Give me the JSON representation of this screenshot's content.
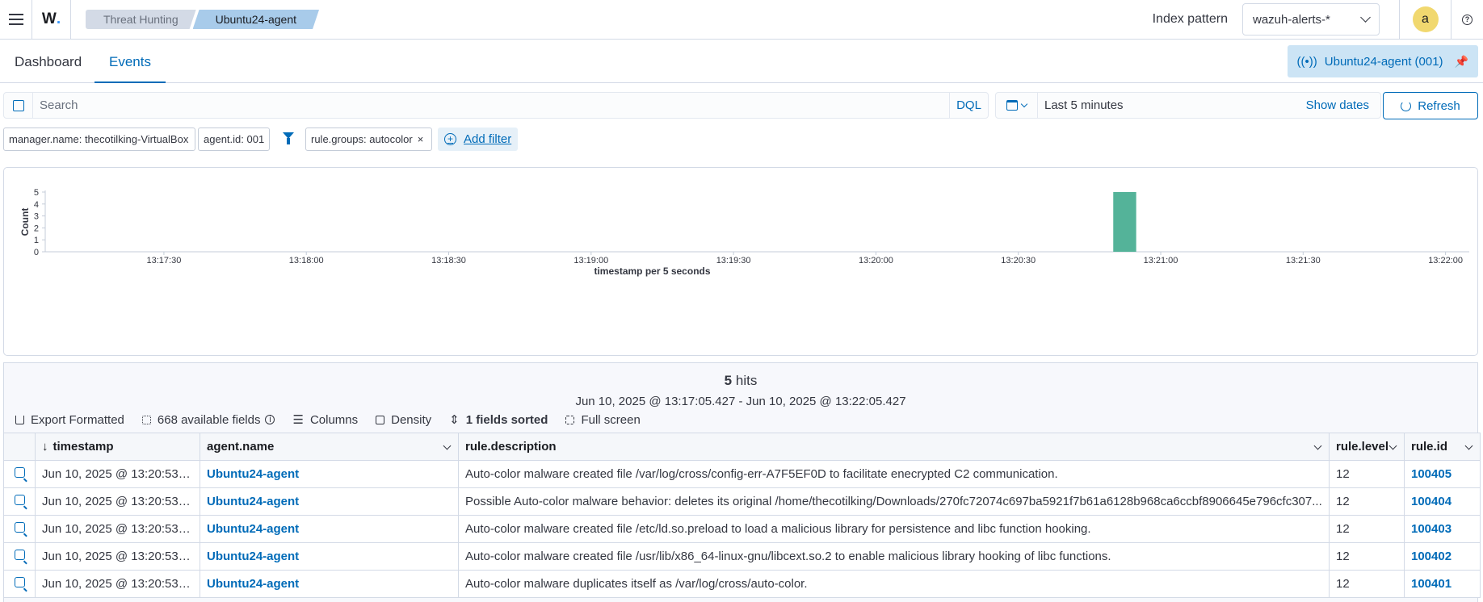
{
  "header": {
    "logo": "W",
    "breadcrumbs": [
      "Threat Hunting",
      "Ubuntu24-agent"
    ],
    "index_pattern_label": "Index pattern",
    "index_pattern_value": "wazuh-alerts-*",
    "avatar_letter": "a"
  },
  "tabs": [
    {
      "label": "Dashboard"
    },
    {
      "label": "Events"
    }
  ],
  "pinned_agent": "Ubuntu24-agent (001)",
  "search": {
    "placeholder": "Search",
    "language": "DQL",
    "time_range": "Last 5 minutes",
    "show_dates": "Show dates",
    "refresh": "Refresh"
  },
  "filters": [
    {
      "label": "manager.name: thecotilking-VirtualBox"
    },
    {
      "label": "agent.id: 001"
    },
    {
      "label": "rule.groups: autocolor"
    }
  ],
  "add_filter": "Add filter",
  "chart_data": {
    "type": "bar",
    "x": [
      "13:20:50"
    ],
    "values": [
      5
    ],
    "ylabel": "Count",
    "xlabel": "timestamp per 5 seconds",
    "ylim": [
      0,
      5
    ],
    "y_ticks": [
      "0",
      "1",
      "2",
      "3",
      "4",
      "5"
    ],
    "x_ticks": [
      "13:17:30",
      "13:18:00",
      "13:18:30",
      "13:19:00",
      "13:19:30",
      "13:20:00",
      "13:20:30",
      "13:21:00",
      "13:21:30",
      "13:22:00"
    ],
    "x_range": [
      "13:17:05",
      "13:22:05"
    ],
    "bar_color": "#54b399",
    "grid": false
  },
  "results": {
    "hits_count": "5",
    "hits_label": "hits",
    "date_range": "Jun 10, 2025 @ 13:17:05.427 - Jun 10, 2025 @ 13:22:05.427",
    "toolbar": {
      "export": "Export Formatted",
      "fields": "668 available fields",
      "columns": "Columns",
      "density": "Density",
      "sorted": "1 fields sorted",
      "fullscreen": "Full screen"
    },
    "columns": [
      "timestamp",
      "agent.name",
      "rule.description",
      "rule.level",
      "rule.id"
    ],
    "rows": [
      {
        "timestamp": "Jun 10, 2025 @ 13:20:53.1...",
        "agent": "Ubuntu24-agent",
        "description": "Auto-color malware created file /var/log/cross/config-err-A7F5EF0D to facilitate enecrypted C2 communication.",
        "level": "12",
        "id": "100405"
      },
      {
        "timestamp": "Jun 10, 2025 @ 13:20:53.1...",
        "agent": "Ubuntu24-agent",
        "description": "Possible Auto-color malware behavior: deletes its original /home/thecotilking/Downloads/270fc72074c697ba5921f7b61a6128b968ca6ccbf8906645e796cfc307...",
        "level": "12",
        "id": "100404"
      },
      {
        "timestamp": "Jun 10, 2025 @ 13:20:53.1...",
        "agent": "Ubuntu24-agent",
        "description": "Auto-color malware created file /etc/ld.so.preload to load a malicious library for persistence and libc function hooking.",
        "level": "12",
        "id": "100403"
      },
      {
        "timestamp": "Jun 10, 2025 @ 13:20:53.1...",
        "agent": "Ubuntu24-agent",
        "description": "Auto-color malware created file /usr/lib/x86_64-linux-gnu/libcext.so.2 to enable malicious library hooking of libc functions.",
        "level": "12",
        "id": "100402"
      },
      {
        "timestamp": "Jun 10, 2025 @ 13:20:53.1...",
        "agent": "Ubuntu24-agent",
        "description": "Auto-color malware duplicates itself as /var/log/cross/auto-color.",
        "level": "12",
        "id": "100401"
      }
    ]
  },
  "colors": {
    "accent": "#006bb8",
    "breadcrumb_active": "#a8cbea",
    "avatar": "#f1d86f"
  }
}
